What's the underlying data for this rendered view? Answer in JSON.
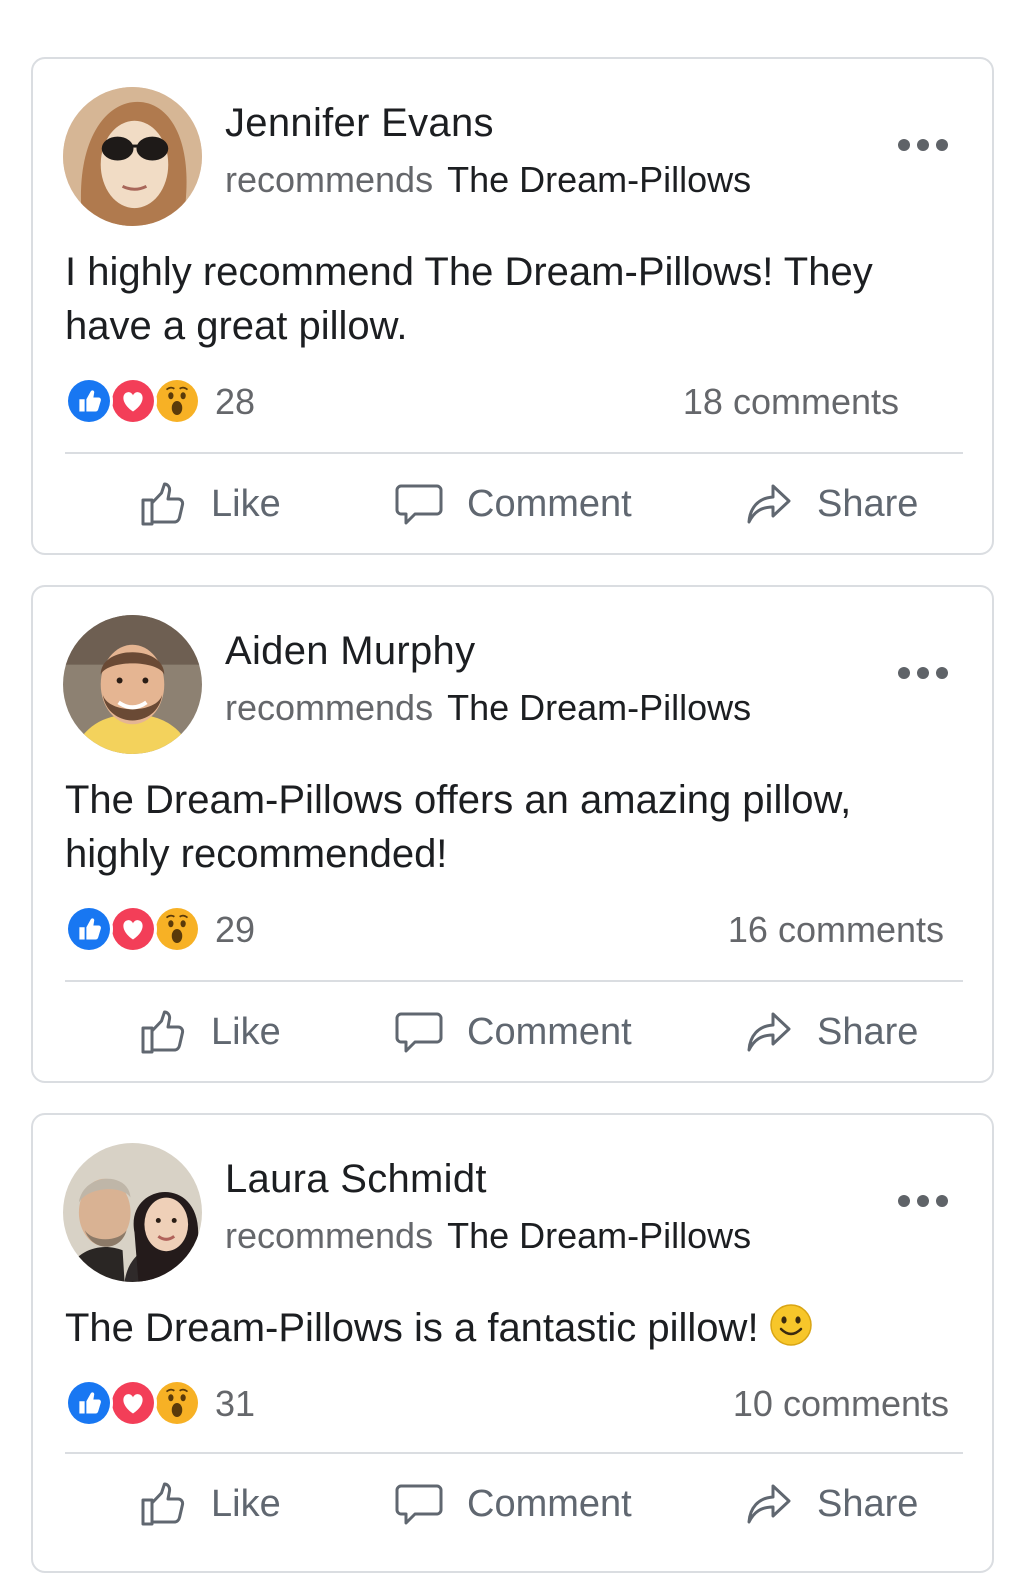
{
  "colors": {
    "like_blue": "#1877f2",
    "love_red": "#f33e58",
    "wow_yellow": "#f7b125",
    "text_primary": "#1c1e21",
    "text_secondary": "#65676b",
    "divider": "#dadde1"
  },
  "posts": [
    {
      "author": "Jennifer Evans",
      "verb": "recommends",
      "page": "The Dream-Pillows",
      "text": "I highly recommend The Dream-Pillows! They have a great pillow.",
      "reactions": [
        "like-icon",
        "love-icon",
        "wow-icon"
      ],
      "reaction_count": "28",
      "comments": "18 comments",
      "actions": {
        "like": "Like",
        "comment": "Comment",
        "share": "Share"
      }
    },
    {
      "author": "Aiden Murphy",
      "verb": "recommends",
      "page": "The Dream-Pillows",
      "text": "The Dream-Pillows offers an amazing pillow, highly recommended!",
      "reactions": [
        "like-icon",
        "love-icon",
        "wow-icon"
      ],
      "reaction_count": "29",
      "comments": "16 comments",
      "actions": {
        "like": "Like",
        "comment": "Comment",
        "share": "Share"
      }
    },
    {
      "author": "Laura Schmidt",
      "verb": "recommends",
      "page": "The Dream-Pillows",
      "text": "The Dream-Pillows is a fantastic pillow!",
      "text_emoji": "smiley-emoji-icon",
      "reactions": [
        "like-icon",
        "love-icon",
        "wow-icon"
      ],
      "reaction_count": "31",
      "comments": "10 comments",
      "actions": {
        "like": "Like",
        "comment": "Comment",
        "share": "Share"
      }
    }
  ]
}
